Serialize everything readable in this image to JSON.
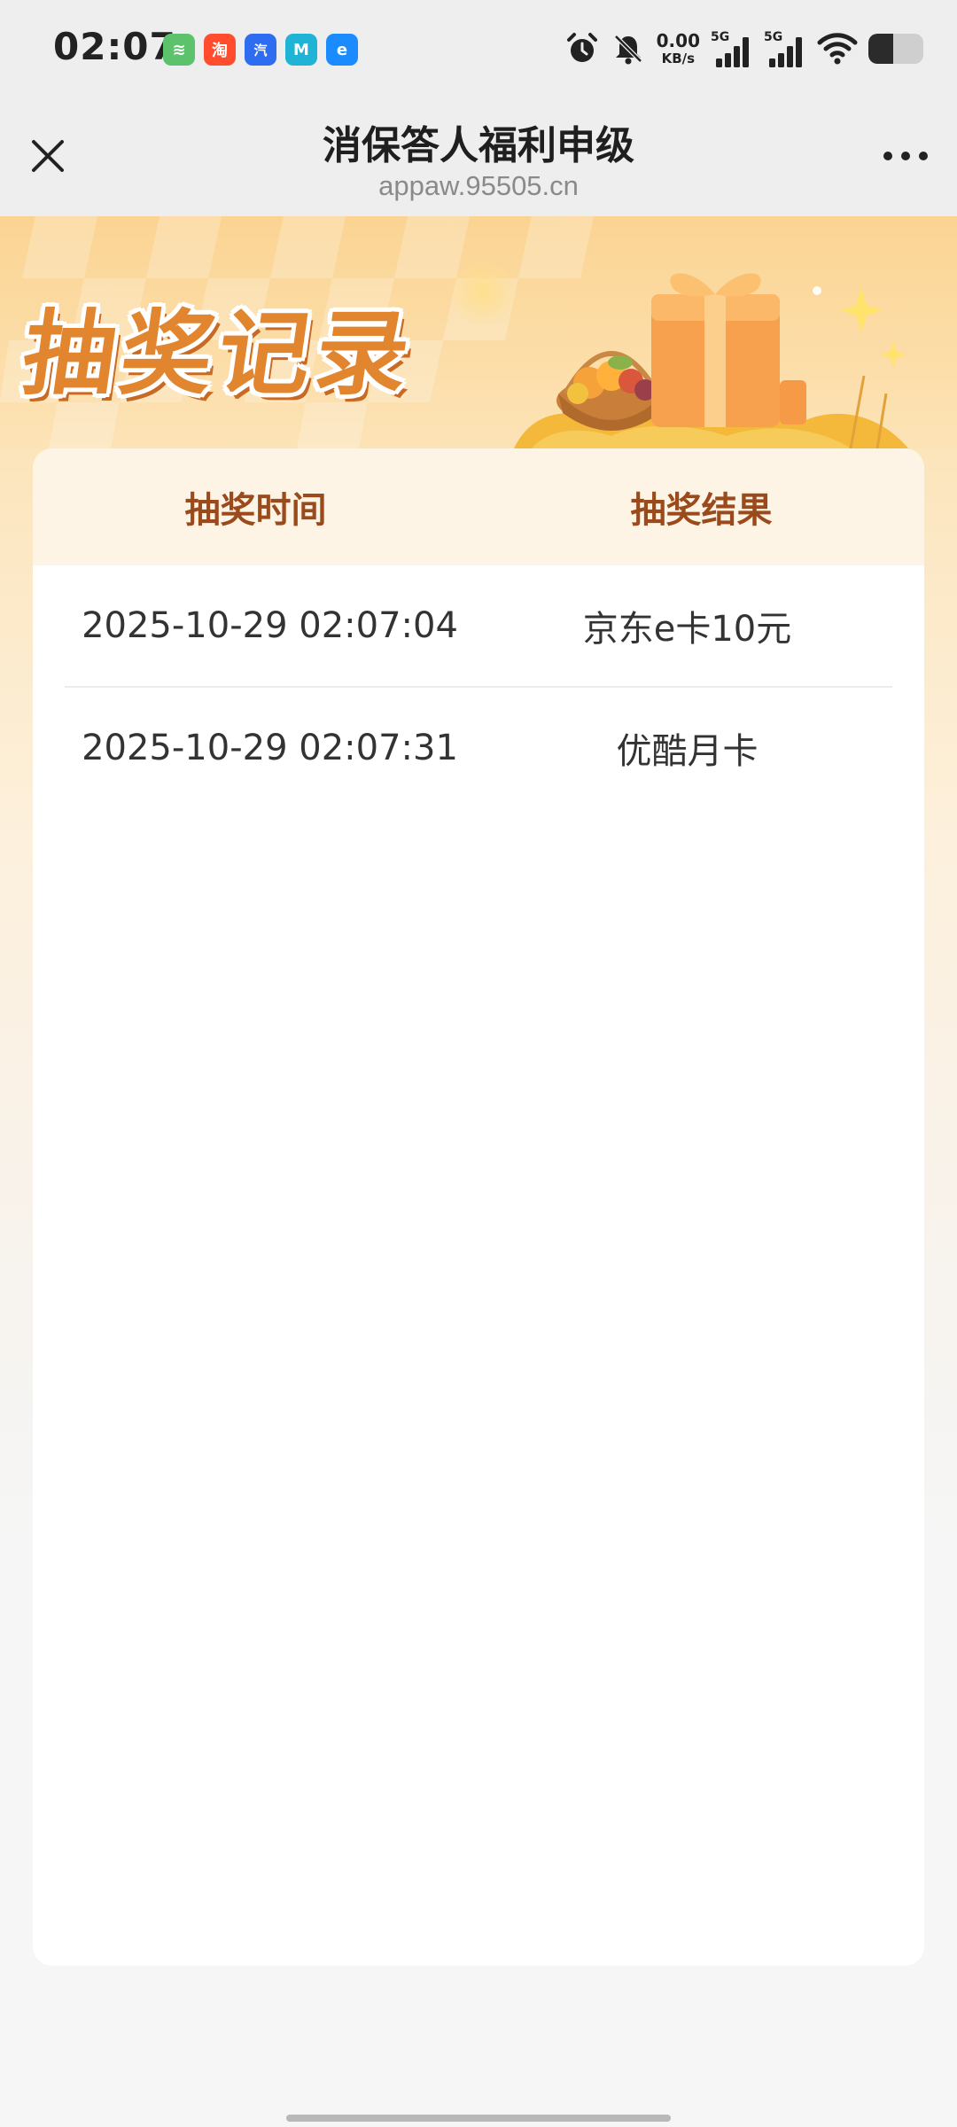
{
  "status_bar": {
    "time": "02:07",
    "app_icons": [
      {
        "name": "app-icon-green",
        "glyph": "≋",
        "color": "#5cc26c"
      },
      {
        "name": "app-icon-taobao",
        "glyph": "淘",
        "color": "#ff4d2e"
      },
      {
        "name": "app-icon-autohome",
        "glyph": "汽",
        "color": "#2f6df0"
      },
      {
        "name": "app-icon-teal",
        "glyph": "M",
        "color": "#1fb3d6"
      },
      {
        "name": "app-icon-eleme",
        "glyph": "e",
        "color": "#1a8cff"
      }
    ],
    "net_speed_value": "0.00",
    "net_speed_unit": "KB/s",
    "signal1_label": "5G",
    "signal2_label": "5G",
    "battery_level": 0.45
  },
  "nav": {
    "title": "消保答人福利申级",
    "url": "appaw.95505.cn"
  },
  "banner": {
    "title": "抽奖记录"
  },
  "table": {
    "columns": [
      "抽奖时间",
      "抽奖结果"
    ],
    "rows": [
      {
        "time": "2025-10-29 02:07:04",
        "result": "京东e卡10元"
      },
      {
        "time": "2025-10-29 02:07:31",
        "result": "优酷月卡"
      }
    ]
  }
}
